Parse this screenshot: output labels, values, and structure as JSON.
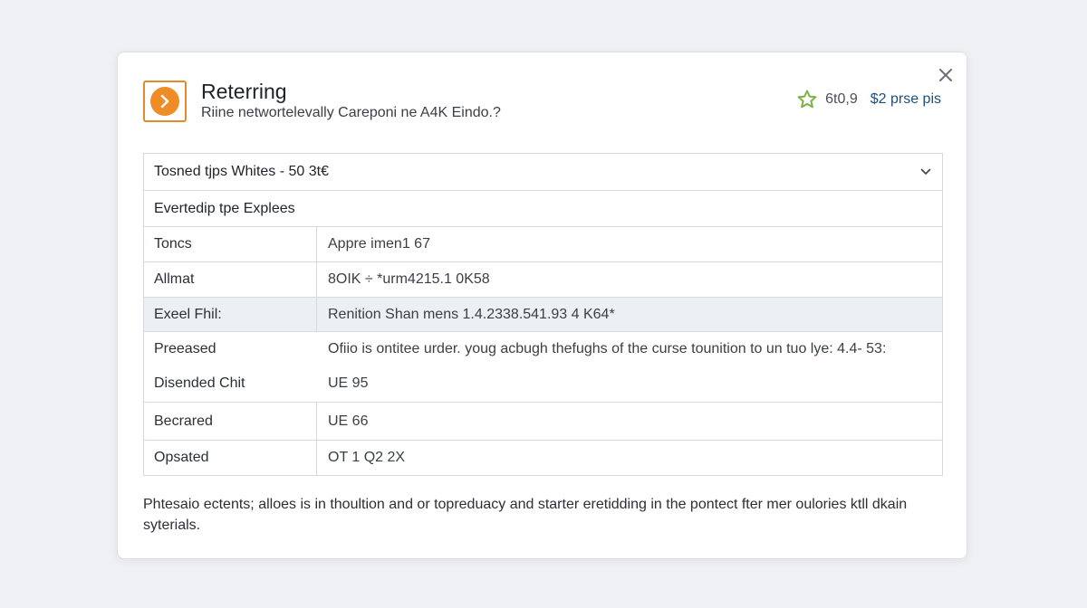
{
  "dialog": {
    "title": "Reterring",
    "subtitle": "Riine networtelevally Careponi ne A4K Eindo.?",
    "rating": {
      "score": "6t0,9",
      "price": "$2 prse pis"
    },
    "dropdown": {
      "label": "Tosned tjps Whites - 50 3t€"
    },
    "section_title": "Evertedip tpe Explees",
    "rows": [
      {
        "key": "Toncs",
        "value": "Appre imen1 67"
      },
      {
        "key": "Allmat",
        "value": "8OIK ÷ *urm4215.1 0K58"
      },
      {
        "key": "Exeel Fhil:",
        "value": "Renition Shan mens 1.4.2338.541.93 4 K64*"
      },
      {
        "key": "Preeased",
        "value": "Ofiio is ontitee urder. youg acbugh thefughs of the curse tounition to un tuo lye: 4.4- 53:"
      },
      {
        "key": "Disended Chit",
        "value": "UE 95"
      },
      {
        "key": "Becrared",
        "value": "UE 66"
      },
      {
        "key": "Opsated",
        "value": "OT 1 Q2 2X"
      }
    ],
    "note": "Phtesaio ectents; alloes is in thoultion and or topreduacy and starter eretidding in the pontect fter mer oulories ktll dkain syterials."
  },
  "colors": {
    "accent_orange": "#f08c26",
    "star_green": "#7cb342",
    "price_blue": "#1d4f7c"
  },
  "icons": [
    "app-play-icon",
    "star-icon",
    "close-icon",
    "chevron-down-icon"
  ]
}
